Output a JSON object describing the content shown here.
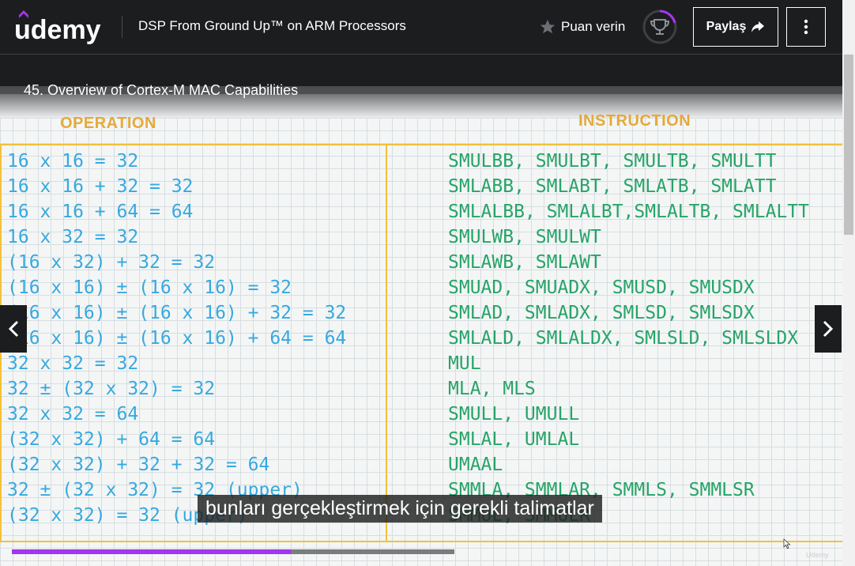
{
  "header": {
    "logo_text": "udemy",
    "course_title": "DSP From Ground Up™ on ARM Processors",
    "rate_label": "Puan verin",
    "share_label": "Paylaş",
    "icons": {
      "rate": "star-icon",
      "progress": "trophy-icon",
      "share": "share-arrow-icon",
      "more": "more-vertical-icon"
    }
  },
  "video": {
    "lecture_title": "45. Overview of Cortex-M MAC Capabilities",
    "slide": {
      "operation_header": "OPERATION",
      "instruction_header": "INSTRUCTION",
      "rows": [
        {
          "operation": "16 x 16 = 32",
          "instruction": "SMULBB, SMULBT, SMULTB, SMULTT"
        },
        {
          "operation": "16 x 16 + 32 = 32",
          "instruction": "SMLABB, SMLABT, SMLATB, SMLATT"
        },
        {
          "operation": "16 x 16 + 64 = 64",
          "instruction": "SMLALBB, SMLALBT,SMLALTB, SMLALTT"
        },
        {
          "operation": "16 x 32 = 32",
          "instruction": "SMULWB, SMULWT"
        },
        {
          "operation": "(16 x 32) + 32 = 32",
          "instruction": "SMLAWB, SMLAWT"
        },
        {
          "operation": "(16 x 16) ± (16 x 16) = 32",
          "instruction": "SMUAD, SMUADX, SMUSD, SMUSDX"
        },
        {
          "operation": "(16 x 16) ± (16 x 16) + 32 = 32",
          "instruction": "SMLAD, SMLADX, SMLSD, SMLSDX"
        },
        {
          "operation": "(16 x 16) ± (16 x 16) + 64 = 64",
          "instruction": "SMLALD, SMLALDX, SMLSLD, SMLSLDX"
        },
        {
          "operation": "32 x 32 = 32",
          "instruction": "MUL"
        },
        {
          "operation": "32 ± (32 x 32) = 32",
          "instruction": "MLA, MLS"
        },
        {
          "operation": "32 x 32 = 64",
          "instruction": "SMULL, UMULL"
        },
        {
          "operation": "(32 x 32) + 64 = 64",
          "instruction": "SMLAL, UMLAL"
        },
        {
          "operation": "(32 x 32) + 32 + 32 = 64",
          "instruction": "UMAAL"
        },
        {
          "operation": "32 ± (32 x 32) = 32 (upper)",
          "instruction": "SMMLA, SMMLAR, SMMLS, SMMLSR"
        },
        {
          "operation": "(32 x 32) = 32 (upper)",
          "instruction": "SMMUL, SMMULR"
        }
      ]
    },
    "caption": "bunları gerçekleştirmek için gerekli talimatlar",
    "progress_fraction": 0.63,
    "watermark": "Udemy",
    "colors": {
      "accent": "#a435f0",
      "operation_text": "#36a9e0",
      "instruction_text": "#27a468",
      "header_text": "#e6a93a",
      "table_border": "#f2c13a"
    }
  }
}
